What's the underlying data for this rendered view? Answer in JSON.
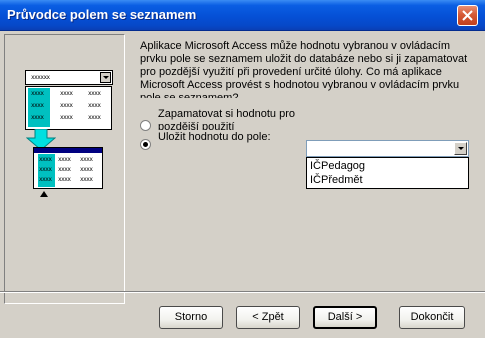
{
  "window": {
    "title": "Průvodce polem se seznamem"
  },
  "illustration": {
    "combo_placeholder": "xxxxxx",
    "grid_cell": "xxxx"
  },
  "description": "Aplikace Microsoft Access může hodnotu vybranou v ovládacím prvku pole se seznamem uložit do databáze nebo si ji zapamatovat pro pozdější využití při provedení určité úlohy. Co má aplikace Microsoft Access provést s hodnotou vybranou v ovládacím prvku pole se seznamem?",
  "options": {
    "store_label": "Zapamatovat si hodnotu pro pozdější použití",
    "save_label": "Uložit hodnotu do pole:",
    "selected": "save"
  },
  "field_select": {
    "value": "",
    "options": [
      "IČPedagog",
      "IČPředmět"
    ]
  },
  "buttons": {
    "cancel": "Storno",
    "back": "< Zpět",
    "next": "Další >",
    "finish": "Dokončit"
  },
  "colors": {
    "titlebar": "#0550d6",
    "dialog_bg": "#d4d0c8",
    "illustration_accent": "#00c0c0",
    "illustration_header": "#000080"
  }
}
